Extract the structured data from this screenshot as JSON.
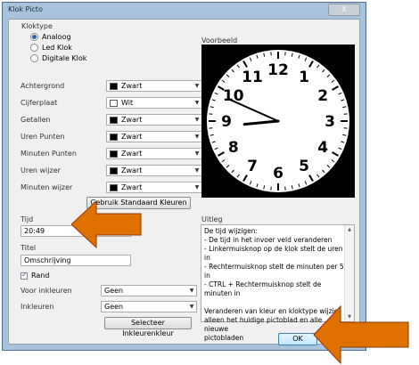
{
  "window": {
    "title": "Klok Picto",
    "close_label": "X"
  },
  "kloktype": {
    "label": "Kloktype",
    "options": [
      {
        "label": "Analoog",
        "checked": true
      },
      {
        "label": "Led Klok",
        "checked": false
      },
      {
        "label": "Digitale Klok",
        "checked": false
      }
    ]
  },
  "colors": [
    {
      "label": "Achtergrond",
      "value": "Zwart",
      "swatch": "#000000"
    },
    {
      "label": "Cijferplaat",
      "value": "Wit",
      "swatch": "#ffffff"
    },
    {
      "label": "Getallen",
      "value": "Zwart",
      "swatch": "#000000"
    },
    {
      "label": "Uren Punten",
      "value": "Zwart",
      "swatch": "#000000"
    },
    {
      "label": "Minuten Punten",
      "value": "Zwart",
      "swatch": "#000000"
    },
    {
      "label": "Uren wijzer",
      "value": "Zwart",
      "swatch": "#000000"
    },
    {
      "label": "Minuten wijzer",
      "value": "Zwart",
      "swatch": "#000000"
    }
  ],
  "standard_colors_button": "Gebruik Standaard Kleuren",
  "preview": {
    "label": "Voorbeeld",
    "numbers": [
      "12",
      "1",
      "2",
      "3",
      "4",
      "5",
      "6",
      "7",
      "8",
      "9",
      "10",
      "11"
    ],
    "time": "20:49"
  },
  "tijd": {
    "label": "Tijd",
    "value": "20:49"
  },
  "titel": {
    "label": "Titel",
    "value": "Omschrijving"
  },
  "rand": {
    "label": "Rand",
    "checked": true
  },
  "voor_inkleuren": {
    "label": "Voor inkleuren",
    "value": "Geen"
  },
  "inkleuren": {
    "label": "Inkleuren",
    "value": "Geen"
  },
  "select_color_button": "Selecteer Inkleurenkleur",
  "uitleg": {
    "label": "Uitleg",
    "text": "De tijd wijzigen:\n- De tijd in het invoer veld veranderen\n- Linkermuisknop op de klok stelt de uren in\n- Rechtermuisknop stelt de minuten per 5 in\n- CTRL + Rechtermuisknop stelt de minuten in\n\nVeranderen van kleur en kloktype wijzigt\nalleen het huidige pictoblad en alle nieuwe\npictobladen"
  },
  "ok_button": "OK",
  "annotation_color": "#e07000"
}
